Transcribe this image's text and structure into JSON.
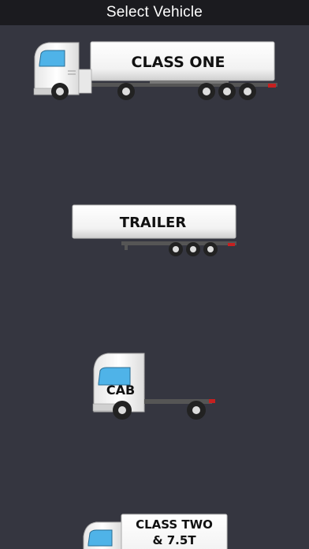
{
  "header": {
    "title": "Select Vehicle"
  },
  "vehicles": [
    {
      "id": "class-one",
      "label": "CLASS ONE"
    },
    {
      "id": "trailer",
      "label": "TRAILER"
    },
    {
      "id": "cab",
      "label": "CAB"
    },
    {
      "id": "class-two",
      "label_line1": "CLASS TWO",
      "label_line2": "& 7.5T"
    }
  ],
  "colors": {
    "background": "#353640",
    "header": "#1b1b1f",
    "truck_body": "#f4f4f4",
    "window": "#4fb3e8"
  }
}
